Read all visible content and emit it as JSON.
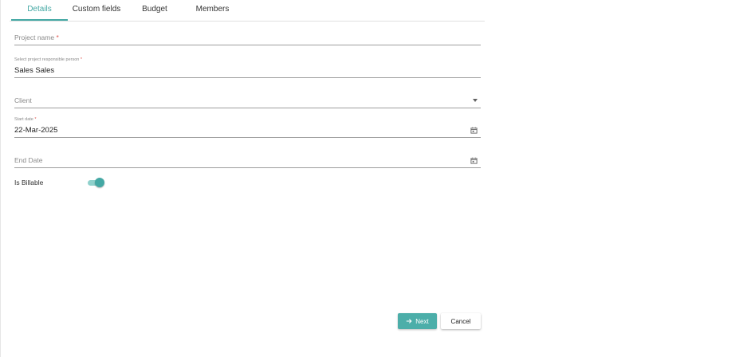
{
  "tabs": [
    {
      "label": "Details",
      "active": true
    },
    {
      "label": "Custom fields",
      "active": false
    },
    {
      "label": "Budget",
      "active": false
    },
    {
      "label": "Members",
      "active": false
    }
  ],
  "form": {
    "project_name": {
      "placeholder": "Project name",
      "required_marker": "*",
      "value": ""
    },
    "responsible_person": {
      "label": "Select project responsible person",
      "required_marker": "*",
      "value": "Sales Sales"
    },
    "client": {
      "placeholder": "Client",
      "value": "",
      "icon": "chevron-down-icon"
    },
    "start_date": {
      "label": "Start date",
      "required_marker": "*",
      "value": "22-Mar-2025",
      "icon": "calendar-icon"
    },
    "end_date": {
      "placeholder": "End Date",
      "value": "",
      "icon": "calendar-icon"
    },
    "is_billable": {
      "label": "Is Billable",
      "checked": true
    }
  },
  "actions": {
    "next_label": "Next",
    "next_icon": "arrow-right-icon",
    "cancel_label": "Cancel"
  },
  "colors": {
    "accent": "#44a8a4",
    "toggle_track": "#8fd1cc",
    "required": "#e0554f",
    "next_button": "#4caea9"
  }
}
